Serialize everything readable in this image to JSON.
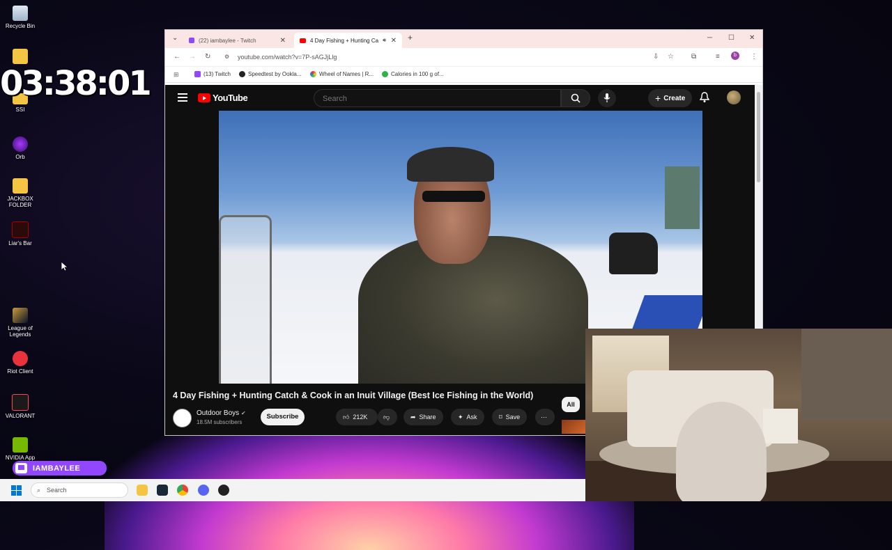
{
  "desktop": {
    "icons": [
      {
        "label": "Recycle Bin"
      },
      {
        "label": "SSI"
      },
      {
        "label": "Orb"
      },
      {
        "label": "JACKBOX FOLDER"
      },
      {
        "label": "Liar's Bar"
      },
      {
        "label": "League of Legends"
      },
      {
        "label": "Riot Client"
      },
      {
        "label": "VALORANT"
      },
      {
        "label": "NVIDIA App"
      }
    ],
    "timer": "03:38:01"
  },
  "browser": {
    "tabs": [
      {
        "label": "(22) iambaylee - Twitch"
      },
      {
        "label": "4 Day Fishing + Hunting Ca"
      }
    ],
    "url": "youtube.com/watch?v=7P-sAGJjLlg",
    "bookmarks": [
      {
        "label": "(13) Twitch"
      },
      {
        "label": "Speedtest by Ookla..."
      },
      {
        "label": "Wheel of Names | R..."
      },
      {
        "label": "Calories in 100 g of..."
      }
    ]
  },
  "youtube": {
    "logo_text": "YouTube",
    "search_placeholder": "Search",
    "create_label": "Create",
    "video_title": "4 Day Fishing + Hunting Catch & Cook in an Inuit Village (Best Ice Fishing in the World)",
    "channel_name": "Outdoor Boys",
    "subscribers": "18.5M subscribers",
    "subscribe_label": "Subscribe",
    "likes": "212K",
    "share_label": "Share",
    "ask_label": "Ask",
    "save_label": "Save",
    "chip_all": "All"
  },
  "overlay": {
    "twitch_name": "IAMBAYLEE"
  },
  "taskbar": {
    "search_placeholder": "Search"
  }
}
